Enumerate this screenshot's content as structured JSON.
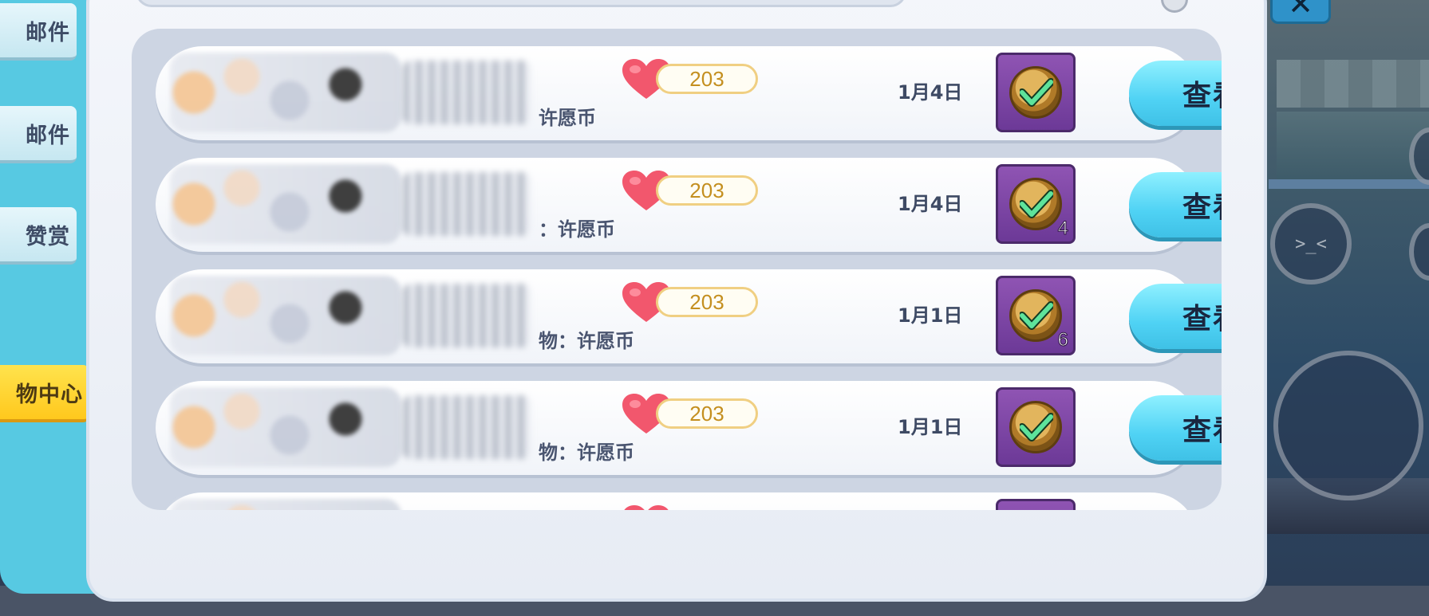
{
  "tabs": [
    {
      "label": "邮件",
      "active": false
    },
    {
      "label": "邮件",
      "active": false
    },
    {
      "label": "赞赏",
      "active": false
    },
    {
      "label": "物中心",
      "active": true
    }
  ],
  "close_label": "✕",
  "records": [
    {
      "likes": "203",
      "gift": "许愿币",
      "date": "1月4日",
      "qty": "",
      "action": "查看"
    },
    {
      "likes": "203",
      "gift": "：许愿币",
      "date": "1月4日",
      "qty": "4",
      "action": "查看"
    },
    {
      "likes": "203",
      "gift": "物：许愿币",
      "date": "1月1日",
      "qty": "6",
      "action": "查看"
    },
    {
      "likes": "203",
      "gift": "物：许愿币",
      "date": "1月1日",
      "qty": "",
      "action": "查看"
    }
  ],
  "colors": {
    "heart": "#f2576d",
    "view_button": "#4fd2f4",
    "badge": "#7a41a4",
    "active_tab": "#ffd22e"
  },
  "icons": {
    "heart": "heart-icon",
    "badge": "check-coin-icon",
    "close": "close-icon"
  }
}
